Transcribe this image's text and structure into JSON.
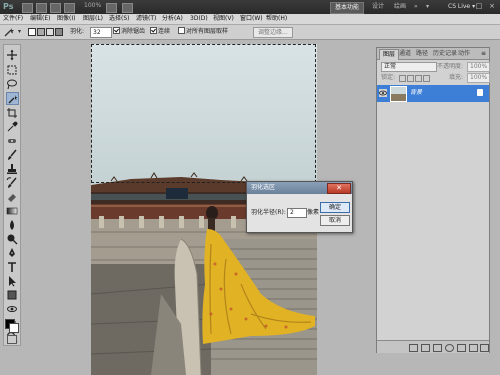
{
  "app": {
    "logo": "Ps",
    "zoom": "100%",
    "essentials": "基本功能",
    "workspaces": [
      "设计",
      "绘画"
    ],
    "more": "»",
    "cs_live": "CS Live",
    "cs_live_arrow": "▾"
  },
  "menu": [
    "文件(F)",
    "编辑(E)",
    "图像(I)",
    "图层(L)",
    "选择(S)",
    "滤镜(T)",
    "分析(A)",
    "3D(D)",
    "视图(V)",
    "窗口(W)",
    "帮助(H)"
  ],
  "options": {
    "feather_label": "羽化:",
    "feather_value": "32",
    "antialias_label": "消除锯齿",
    "contiguous_label": "连续",
    "sample_all_label": "对所有图层取样",
    "refine_edge_label": "调整边缘..."
  },
  "dialog": {
    "title": "羽化选区",
    "close": "✕",
    "radius_label": "羽化半径(R):",
    "radius_value": "2",
    "unit": "像素",
    "ok": "确定",
    "cancel": "取消"
  },
  "layers_panel": {
    "tabs": [
      "图层",
      "通道",
      "路径",
      "历史记录",
      "动作"
    ],
    "blend_mode": "正常",
    "opacity_label": "不透明度:",
    "opacity_value": "100%",
    "lock_label": "锁定:",
    "fill_label": "填充:",
    "fill_value": "100%",
    "layer_name": "背景"
  },
  "colors": {
    "selected_layer": "#3d7fd6",
    "dialog_titlebar": "#7a8fa8",
    "dress": "#e1b224"
  }
}
